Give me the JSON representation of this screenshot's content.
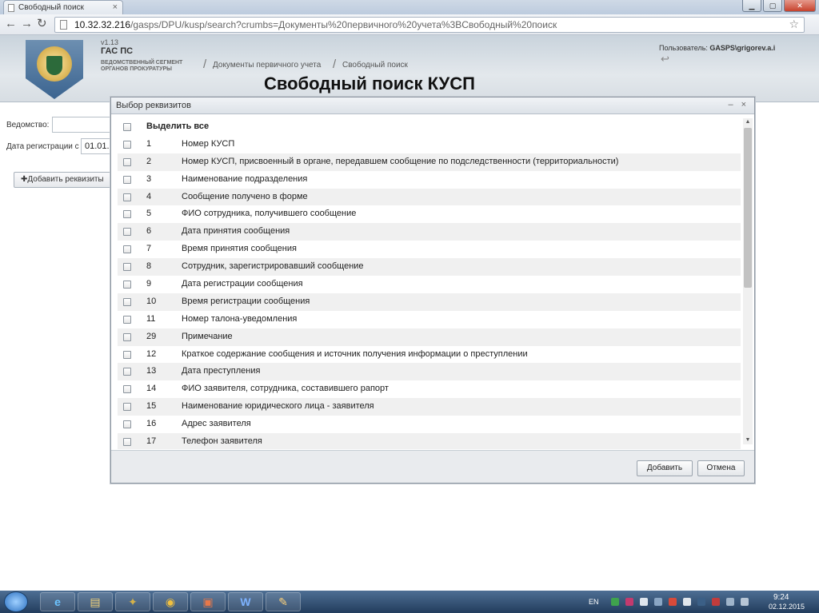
{
  "browser": {
    "tab_title": "Свободный поиск",
    "url_host": "10.32.32.216",
    "url_rest": "/gasps/DPU/kusp/search?crumbs=Документы%20первичного%20учета%3BСвободный%20поиск"
  },
  "header": {
    "version": "v1.13",
    "system_name": "ГАС ПС",
    "org_line1": "ВЕДОМСТВЕННЫЙ СЕГМЕНТ",
    "org_line2": "ОРГАНОВ ПРОКУРАТУРЫ",
    "breadcrumbs": [
      "Документы первичного учета",
      "Свободный поиск"
    ],
    "user_label": "Пользователь:",
    "user_name": "GASPS\\grigorev.a.i",
    "page_title": "Свободный поиск КУСП"
  },
  "form": {
    "department_label": "Ведомство:",
    "department_value": "",
    "reg_date_label": "Дата регистрации с",
    "reg_date_value": "01.01.",
    "add_requisites_label": "Добавить реквизиты"
  },
  "modal": {
    "title": "Выбор реквизитов",
    "select_all": "Выделить все",
    "items": [
      {
        "num": "1",
        "label": "Номер КУСП"
      },
      {
        "num": "2",
        "label": "Номер КУСП, присвоенный в органе, передавшем сообщение по подследственности (территориальности)"
      },
      {
        "num": "3",
        "label": "Наименование подразделения"
      },
      {
        "num": "4",
        "label": "Сообщение получено в форме"
      },
      {
        "num": "5",
        "label": "ФИО сотрудника, получившего сообщение"
      },
      {
        "num": "6",
        "label": "Дата принятия сообщения"
      },
      {
        "num": "7",
        "label": "Время принятия сообщения"
      },
      {
        "num": "8",
        "label": "Сотрудник, зарегистрировавший сообщение"
      },
      {
        "num": "9",
        "label": "Дата регистрации сообщения"
      },
      {
        "num": "10",
        "label": "Время регистрации сообщения"
      },
      {
        "num": "11",
        "label": "Номер талона-уведомления"
      },
      {
        "num": "29",
        "label": "Примечание"
      },
      {
        "num": "12",
        "label": "Краткое содержание сообщения и источник получения информации о преступлении"
      },
      {
        "num": "13",
        "label": "Дата преступления"
      },
      {
        "num": "14",
        "label": "ФИО заявителя, сотрудника, составившего рапорт"
      },
      {
        "num": "15",
        "label": "Наименование юридического лица - заявителя"
      },
      {
        "num": "16",
        "label": "Адрес заявителя"
      },
      {
        "num": "17",
        "label": "Телефон заявителя"
      }
    ],
    "add_button": "Добавить",
    "cancel_button": "Отмена"
  },
  "taskbar": {
    "language": "EN",
    "time": "9:24",
    "date": "02.12.2015"
  }
}
